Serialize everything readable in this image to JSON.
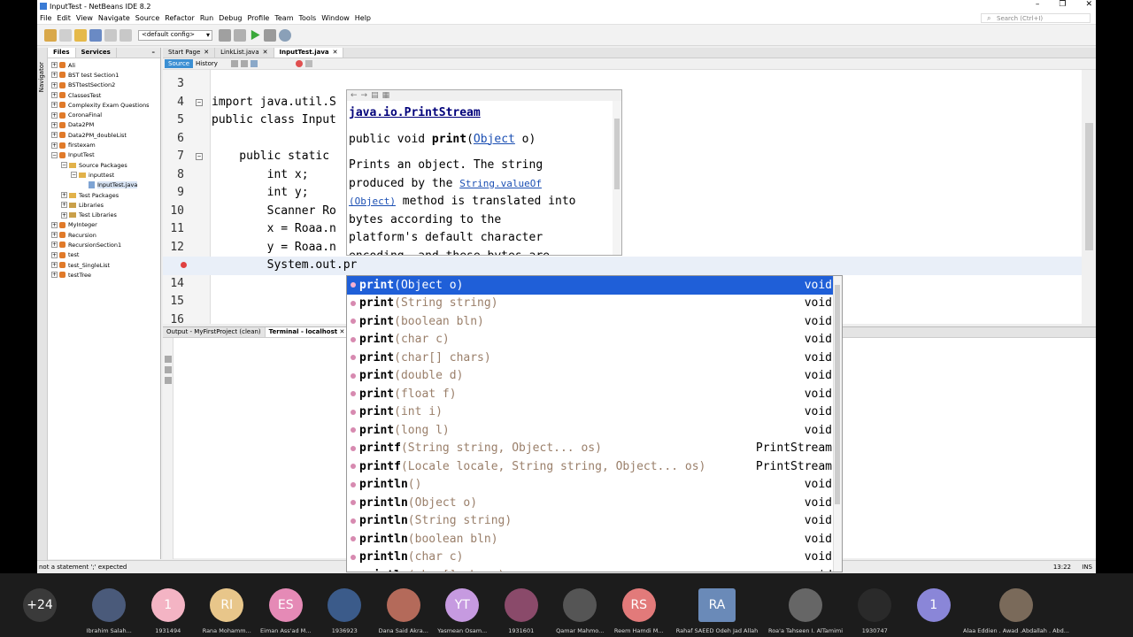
{
  "window": {
    "title": "InputTest - NetBeans IDE 8.2",
    "controls": [
      "–",
      "❐",
      "✕"
    ]
  },
  "menu": [
    "File",
    "Edit",
    "View",
    "Navigate",
    "Source",
    "Refactor",
    "Run",
    "Debug",
    "Profile",
    "Team",
    "Tools",
    "Window",
    "Help"
  ],
  "search_placeholder": "Search (Ctrl+I)",
  "config": "<default config>",
  "side_strip": "Navigator",
  "project_tabs": {
    "files": "Files",
    "services": "Services"
  },
  "tree": [
    {
      "label": "Ali",
      "depth": 0,
      "kind": "project"
    },
    {
      "label": "BST test Section1",
      "depth": 0,
      "kind": "project"
    },
    {
      "label": "BSTtestSection2",
      "depth": 0,
      "kind": "project"
    },
    {
      "label": "ClassesTest",
      "depth": 0,
      "kind": "project"
    },
    {
      "label": "Complexity Exam Questions",
      "depth": 0,
      "kind": "project"
    },
    {
      "label": "CoronaFinal",
      "depth": 0,
      "kind": "project"
    },
    {
      "label": "Data2PM",
      "depth": 0,
      "kind": "project"
    },
    {
      "label": "Data2PM_doubleList",
      "depth": 0,
      "kind": "project"
    },
    {
      "label": "firstexam",
      "depth": 0,
      "kind": "project"
    },
    {
      "label": "InputTest",
      "depth": 0,
      "kind": "project"
    },
    {
      "label": "Source Packages",
      "depth": 1,
      "kind": "folder"
    },
    {
      "label": "inputtest",
      "depth": 2,
      "kind": "folder"
    },
    {
      "label": "InputTest.java",
      "depth": 3,
      "kind": "java"
    },
    {
      "label": "Test Packages",
      "depth": 1,
      "kind": "folder"
    },
    {
      "label": "Libraries",
      "depth": 1,
      "kind": "lib"
    },
    {
      "label": "Test Libraries",
      "depth": 1,
      "kind": "lib"
    },
    {
      "label": "MyInteger",
      "depth": 0,
      "kind": "project"
    },
    {
      "label": "Recursion",
      "depth": 0,
      "kind": "project"
    },
    {
      "label": "RecursionSection1",
      "depth": 0,
      "kind": "project"
    },
    {
      "label": "test",
      "depth": 0,
      "kind": "project"
    },
    {
      "label": "test_SingleList",
      "depth": 0,
      "kind": "project"
    },
    {
      "label": "testTree",
      "depth": 0,
      "kind": "project"
    }
  ],
  "editor_tabs": [
    "Start Page",
    "LinkList.java",
    "InputTest.java"
  ],
  "source_bar": {
    "source": "Source",
    "history": "History"
  },
  "code_lines": [
    {
      "n": "3",
      "code": ""
    },
    {
      "n": "4",
      "code": "import java.util.S"
    },
    {
      "n": "5",
      "code": "public class Input"
    },
    {
      "n": "6",
      "code": ""
    },
    {
      "n": "7",
      "code": "    public static"
    },
    {
      "n": "8",
      "code": "        int x;"
    },
    {
      "n": "9",
      "code": "        int y;"
    },
    {
      "n": "10",
      "code": "        Scanner Ro"
    },
    {
      "n": "11",
      "code": "        x = Roaa.n"
    },
    {
      "n": "12",
      "code": "        y = Roaa.n"
    },
    {
      "n": "",
      "code": "        System.out.pr"
    },
    {
      "n": "14",
      "code": ""
    },
    {
      "n": "15",
      "code": ""
    },
    {
      "n": "16",
      "code": ""
    }
  ],
  "output_tabs": [
    "Output - MyFirstProject (clean)",
    "Terminal - localhost"
  ],
  "status": {
    "message": "not a statement ';' expected",
    "position": "13:22",
    "mode": "INS"
  },
  "javadoc": {
    "class": "java.io.PrintStream",
    "sig_prefix": "public void ",
    "sig_method": "print",
    "sig_open": "(",
    "sig_type": "Object",
    "sig_rest": " o)",
    "desc1": "Prints an object. The string",
    "desc2a": "produced by the ",
    "desc2_link": "String.valueOf",
    "desc3_link": "(Object)",
    "desc3b": " method is translated into",
    "desc4": "bytes according to the",
    "desc5": "platform's default character",
    "desc6": "encoding, and these bytes are"
  },
  "completions": [
    {
      "name": "print",
      "params": "(Object o)",
      "ret": "void"
    },
    {
      "name": "print",
      "params": "(String string)",
      "ret": "void"
    },
    {
      "name": "print",
      "params": "(boolean bln)",
      "ret": "void"
    },
    {
      "name": "print",
      "params": "(char c)",
      "ret": "void"
    },
    {
      "name": "print",
      "params": "(char[] chars)",
      "ret": "void"
    },
    {
      "name": "print",
      "params": "(double d)",
      "ret": "void"
    },
    {
      "name": "print",
      "params": "(float f)",
      "ret": "void"
    },
    {
      "name": "print",
      "params": "(int i)",
      "ret": "void"
    },
    {
      "name": "print",
      "params": "(long l)",
      "ret": "void"
    },
    {
      "name": "printf",
      "params": "(String string, Object... os)",
      "ret": "PrintStream"
    },
    {
      "name": "printf",
      "params": "(Locale locale, String string, Object... os)",
      "ret": "PrintStream"
    },
    {
      "name": "println",
      "params": "()",
      "ret": "void"
    },
    {
      "name": "println",
      "params": "(Object o)",
      "ret": "void"
    },
    {
      "name": "println",
      "params": "(String string)",
      "ret": "void"
    },
    {
      "name": "println",
      "params": "(boolean bln)",
      "ret": "void"
    },
    {
      "name": "println",
      "params": "(char c)",
      "ret": "void"
    },
    {
      "name": "println",
      "params": "(char[] chars)",
      "ret": "void"
    }
  ],
  "participants": [
    {
      "initials": "+24",
      "name": "",
      "color": "#3a3a3a"
    },
    {
      "initials": "",
      "name": "Ibrahim Salah...",
      "color": "#4a5a7a"
    },
    {
      "initials": "1",
      "name": "1931494",
      "color": "#f4b4c4"
    },
    {
      "initials": "RI",
      "name": "Rana Mohamm...",
      "color": "#e8c68a"
    },
    {
      "initials": "ES",
      "name": "Eiman Ass'ad M...",
      "color": "#e58ab6"
    },
    {
      "initials": "",
      "name": "1936923",
      "color": "#3b5b8a"
    },
    {
      "initials": "",
      "name": "Dana Said Akra...",
      "color": "#b46a5a"
    },
    {
      "initials": "YT",
      "name": "Yasmean Osam...",
      "color": "#c69ae0"
    },
    {
      "initials": "",
      "name": "1931601",
      "color": "#8a4a6a"
    },
    {
      "initials": "",
      "name": "Qamar Mahmo...",
      "color": "#555555"
    },
    {
      "initials": "RS",
      "name": "Reem Hamdi M...",
      "color": "#e27a7a"
    },
    {
      "initials": "RA",
      "name": "Rahaf SAEED Odeh Jad Allah",
      "color": "#6a8ab8"
    },
    {
      "initials": "",
      "name": "Roa'a Tahseen I. AlTamimi",
      "color": "#666666"
    },
    {
      "initials": "",
      "name": "1930747",
      "color": "#2a2a2a"
    },
    {
      "initials": "1",
      "name": "",
      "color": "#8a86d8"
    },
    {
      "initials": "",
      "name": "Alaa Eddien . Awad .Abdallah . Abd...",
      "color": "#7a6a5a"
    }
  ]
}
